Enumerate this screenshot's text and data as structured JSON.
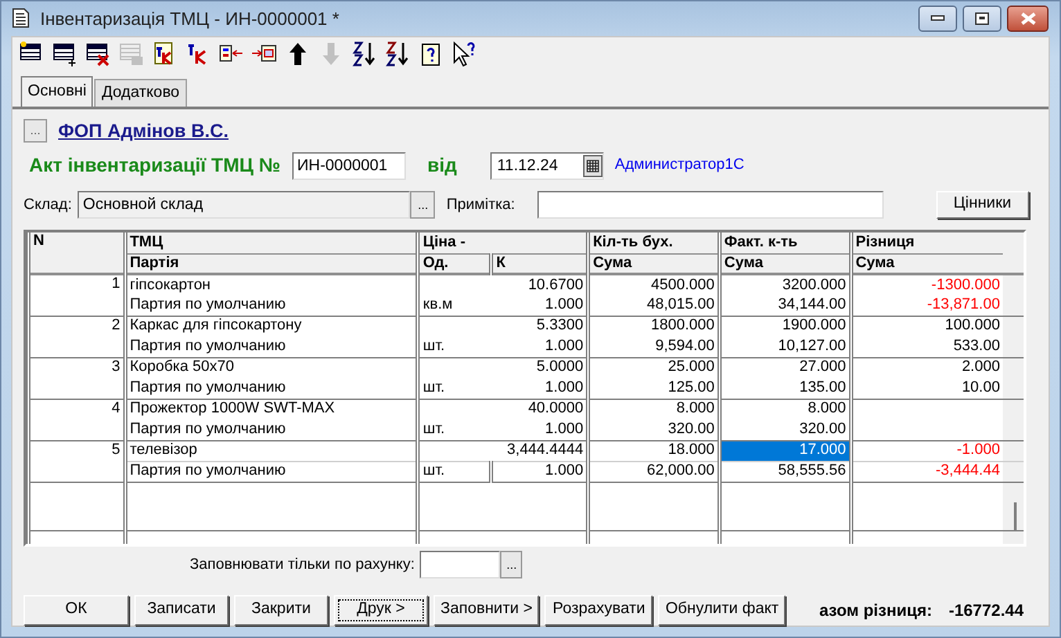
{
  "window": {
    "title": "Інвентаризація ТМЦ - ИН-0000001 *"
  },
  "toolbar": [
    {
      "kind": "table-star",
      "disabled": false
    },
    {
      "kind": "table-add",
      "disabled": false
    },
    {
      "kind": "table-delete",
      "disabled": false
    },
    {
      "kind": "table-copy",
      "disabled": true
    },
    {
      "kind": "dk-doc",
      "disabled": false
    },
    {
      "kind": "dk",
      "disabled": false
    },
    {
      "kind": "move-left",
      "disabled": false
    },
    {
      "kind": "move-right",
      "disabled": false
    },
    {
      "kind": "up",
      "disabled": false
    },
    {
      "kind": "down",
      "disabled": true
    },
    {
      "kind": "sort-az",
      "disabled": false
    },
    {
      "kind": "sort-za",
      "disabled": false
    },
    {
      "kind": "help",
      "disabled": false
    },
    {
      "kind": "pointer-help",
      "disabled": false
    }
  ],
  "tabs": [
    {
      "label": "Основні",
      "selected": true
    },
    {
      "label": "Додатково",
      "selected": false
    }
  ],
  "organization": {
    "button": "...",
    "name": "ФОП Адмінов В.С."
  },
  "document": {
    "title": "Акт інвентаризації ТМЦ №",
    "number": "ИН-0000001",
    "date_label": "від",
    "date": "11.12.24",
    "author": "Администратор1С"
  },
  "warehouse": {
    "label": "Склад:",
    "value": "Основной склад",
    "button": "..."
  },
  "note": {
    "label": "Примітка:"
  },
  "price_tags_button": "Цінники",
  "table": {
    "columns": [
      {
        "label": "N"
      },
      {
        "label": "ТМЦ",
        "sub": [
          "Партія"
        ]
      },
      {
        "label": "Ціна -",
        "sub": [
          "Од.",
          "К"
        ]
      },
      {
        "label": "Кіл-ть бух.",
        "sub": [
          "Сума"
        ]
      },
      {
        "label": "Факт. к-ть",
        "sub": [
          "Сума"
        ]
      },
      {
        "label": "Різниця",
        "sub": [
          "Сума"
        ]
      }
    ],
    "rows": [
      {
        "n": "1",
        "name": "гіпсокартон",
        "batch": "Партия по умолчанию",
        "unit": "кв.м",
        "price": "10.6700",
        "coef": "1.000",
        "qty_book": "4500.000",
        "sum_book": "48,015.00",
        "qty_fact": "3200.000",
        "sum_fact": "34,144.00",
        "diff_qty": "-1300.000",
        "diff_sum": "-13,871.00",
        "negative": true,
        "selected": false
      },
      {
        "n": "2",
        "name": "Каркас для гіпсокартону",
        "batch": "Партия по умолчанию",
        "unit": "шт.",
        "price": "5.3300",
        "coef": "1.000",
        "qty_book": "1800.000",
        "sum_book": "9,594.00",
        "qty_fact": "1900.000",
        "sum_fact": "10,127.00",
        "diff_qty": "100.000",
        "diff_sum": "533.00",
        "negative": false,
        "selected": false
      },
      {
        "n": "3",
        "name": "Коробка 50x70",
        "batch": "Партия по умолчанию",
        "unit": "шт.",
        "price": "5.0000",
        "coef": "1.000",
        "qty_book": "25.000",
        "sum_book": "125.00",
        "qty_fact": "27.000",
        "sum_fact": "135.00",
        "diff_qty": "2.000",
        "diff_sum": "10.00",
        "negative": false,
        "selected": false
      },
      {
        "n": "4",
        "name": "Прожектор 1000W SWT-MAX",
        "batch": "Партия по умолчанию",
        "unit": "шт.",
        "price": "40.0000",
        "coef": "1.000",
        "qty_book": "8.000",
        "sum_book": "320.00",
        "qty_fact": "8.000",
        "sum_fact": "320.00",
        "negative": false,
        "selected": false
      },
      {
        "n": "5",
        "name": "телевізор",
        "batch": "Партия по умолчанию",
        "unit": "шт.",
        "price": "3,444.4444",
        "coef": "1.000",
        "qty_book": "18.000",
        "sum_book": "62,000.00",
        "qty_fact": "17.000",
        "sum_fact": "58,555.56",
        "diff_qty": "-1.000",
        "diff_sum": "-3,444.44",
        "negative": true,
        "selected": true
      }
    ]
  },
  "fill_by_account": {
    "label": "Заповнювати тільки по рахунку:",
    "button": "..."
  },
  "buttons": [
    {
      "label": "ОК",
      "focused": false
    },
    {
      "label": "Записати",
      "focused": false
    },
    {
      "label": "Закрити",
      "focused": false
    },
    {
      "label": "Друк >",
      "focused": true
    },
    {
      "label": "Заповнити >",
      "focused": false
    },
    {
      "label": "Розрахувати",
      "focused": false
    },
    {
      "label": "Обнулити факт",
      "focused": false
    }
  ],
  "total": {
    "label": "азом різниця:",
    "value": "-16772.44"
  }
}
